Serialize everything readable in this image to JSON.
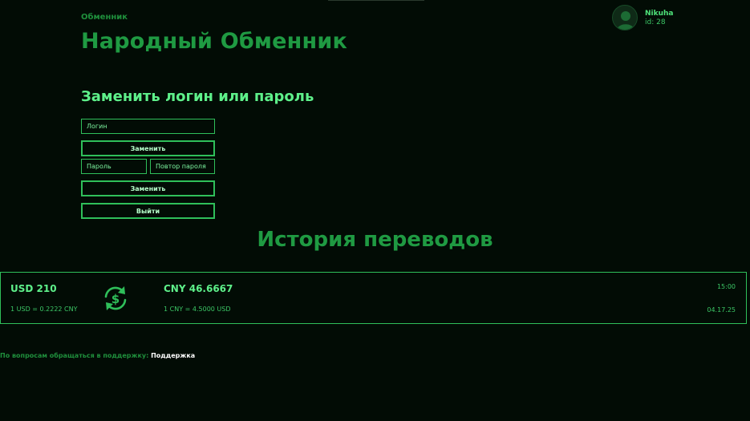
{
  "header": {
    "breadcrumb": "Обменник",
    "title": "Народный Обменник"
  },
  "user": {
    "name": "Nikuha",
    "id_label": "id: 28"
  },
  "credentials": {
    "section_title": "Заменить логин или пароль",
    "login_placeholder": "Логин",
    "replace_login_label": "Заменить",
    "password_placeholder": "Пароль",
    "password_repeat_placeholder": "Повтор пароля",
    "replace_password_label": "Заменить",
    "logout_label": "Выйти"
  },
  "history": {
    "title": "История переводов",
    "transfers": [
      {
        "from_amount": "USD 210",
        "from_rate": "1 USD = 0.2222 CNY",
        "to_amount": "CNY 46.6667",
        "to_rate": "1 CNY = 4.5000 USD",
        "time": "15:00",
        "date": "04.17.25"
      }
    ]
  },
  "footer": {
    "text": "По вопросам обращаться в поддержку:",
    "link_label": "Поддержка"
  },
  "icons": {
    "avatar": "user-avatar-icon",
    "exchange": "currency-exchange-icon"
  },
  "colors": {
    "background": "#020c05",
    "accent": "#2fbf5a",
    "title": "#1f9a42",
    "highlight": "#5ef08a"
  }
}
